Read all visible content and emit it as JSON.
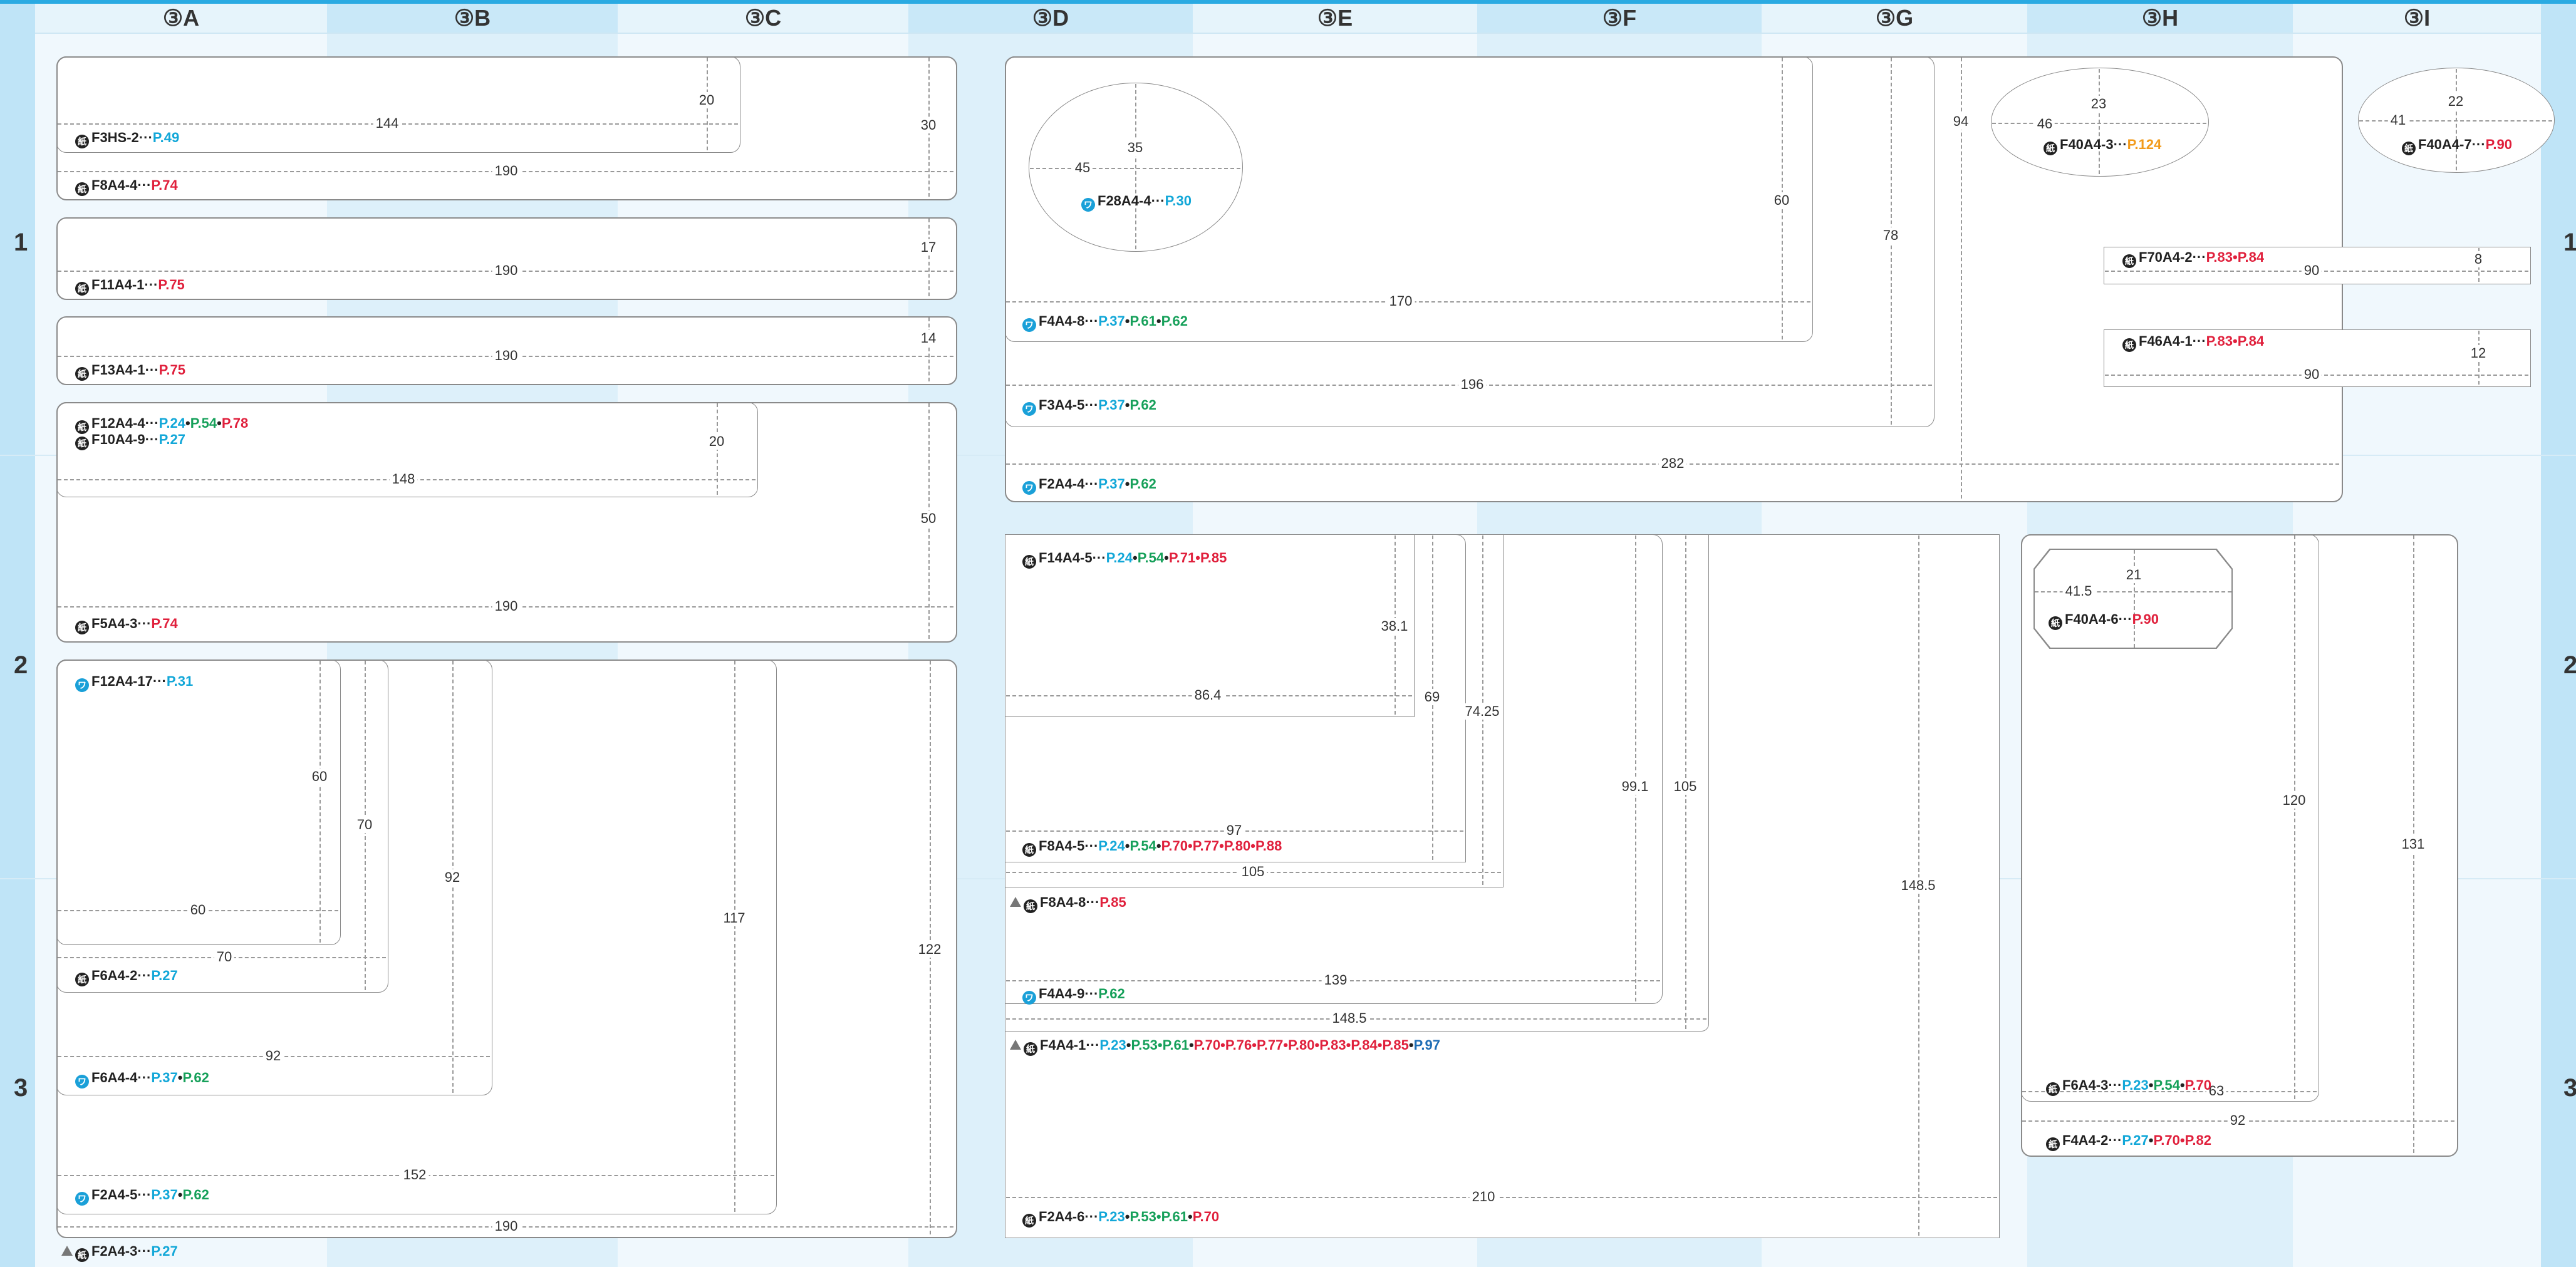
{
  "columns": [
    "③A",
    "③B",
    "③C",
    "③D",
    "③E",
    "③F",
    "③G",
    "③H",
    "③I"
  ],
  "rows": [
    "1",
    "2",
    "3"
  ],
  "dims": {
    "a1": "20",
    "a2": "144",
    "a3": "30",
    "a4": "190",
    "a5": "17",
    "a6": "190",
    "a7": "14",
    "a8": "190",
    "a9": "20",
    "a10": "148",
    "a11": "50",
    "a12": "190",
    "b1": "60",
    "b2": "60",
    "b3": "70",
    "b4": "70",
    "b5": "92",
    "b6": "92",
    "b7": "117",
    "b8": "152",
    "b9": "122",
    "b10": "190",
    "d1": "35",
    "d2": "45",
    "d3": "60",
    "d4": "170",
    "d5": "78",
    "d6": "196",
    "d7": "94",
    "d8": "282",
    "h1": "23",
    "h2": "46",
    "i1": "22",
    "i2": "41",
    "h3": "8",
    "h4": "90",
    "h5": "12",
    "h6": "90",
    "e1": "38.1",
    "e2": "86.4",
    "e3": "69",
    "e4": "74.25",
    "e5": "97",
    "e6": "105",
    "e7": "99.1",
    "e8": "105",
    "e9": "139",
    "e10": "148.5",
    "e11": "148.5",
    "e12": "210",
    "h7": "21",
    "h8": "41.5",
    "h9": "120",
    "h10": "131",
    "h11": "63",
    "h12": "92"
  },
  "labels": {
    "f3hs2": {
      "code": "F3HS-2",
      "pages": "P.49"
    },
    "f8a44": {
      "code": "F8A4-4",
      "pages": "P.74"
    },
    "f11a41": {
      "code": "F11A4-1",
      "pages": "P.75"
    },
    "f13a41": {
      "code": "F13A4-1",
      "pages": "P.75"
    },
    "f12a44": {
      "code": "F12A4-4",
      "p1": "P.24",
      "p2": "P.54",
      "p3": "P.78"
    },
    "f10a49": {
      "code": "F10A4-9",
      "pages": "P.27"
    },
    "f5a43": {
      "code": "F5A4-3",
      "pages": "P.74"
    },
    "f12a417": {
      "code": "F12A4-17",
      "pages": "P.31"
    },
    "f6a42": {
      "code": "F6A4-2",
      "pages": "P.27"
    },
    "f6a44": {
      "code": "F6A4-4",
      "p1": "P.37",
      "p2": "P.62"
    },
    "f2a45": {
      "code": "F2A4-5",
      "p1": "P.37",
      "p2": "P.62"
    },
    "f2a43": {
      "code": "F2A4-3",
      "pages": "P.27"
    },
    "f28a44": {
      "code": "F28A4-4",
      "pages": "P.30"
    },
    "f4a48": {
      "code": "F4A4-8",
      "p1": "P.37",
      "p2": "P.61",
      "p3": "P.62"
    },
    "f3a45": {
      "code": "F3A4-5",
      "p1": "P.37",
      "p2": "P.62"
    },
    "f2a44": {
      "code": "F2A4-4",
      "p1": "P.37",
      "p2": "P.62"
    },
    "f40a43": {
      "code": "F40A4-3",
      "pages": "P.124"
    },
    "f40a47": {
      "code": "F40A4-7",
      "pages": "P.90"
    },
    "f70a42": {
      "code": "F70A4-2",
      "pages": "P.83•P.84"
    },
    "f46a41": {
      "code": "F46A4-1",
      "pages": "P.83•P.84"
    },
    "f14a45": {
      "code": "F14A4-5",
      "p1": "P.24",
      "p2": "P.54",
      "p3": "P.71•P.85"
    },
    "f8a45": {
      "code": "F8A4-5",
      "p1": "P.24",
      "p2": "P.54",
      "p3": "P.70•P.77•P.80•P.88"
    },
    "f8a48": {
      "code": "F8A4-8",
      "pages": "P.85"
    },
    "f4a49": {
      "code": "F4A4-9",
      "pages": "P.62"
    },
    "f4a41": {
      "code": "F4A4-1",
      "p1": "P.23",
      "p2": "P.53•P.61",
      "p3": "P.70•P.76•P.77•P.80•P.83•P.84•P.85",
      "p4": "P.97"
    },
    "f2a46": {
      "code": "F2A4-6",
      "p1": "P.23",
      "p2": "P.53•P.61",
      "p3": "P.70"
    },
    "f40a46": {
      "code": "F40A4-6",
      "pages": "P.90"
    },
    "f6a43": {
      "code": "F6A4-3",
      "p1": "P.23",
      "p2": "P.54",
      "p3": "P.70"
    },
    "f4a42": {
      "code": "F4A4-2",
      "p1": "P.27",
      "p2": "P.70•P.82"
    }
  }
}
